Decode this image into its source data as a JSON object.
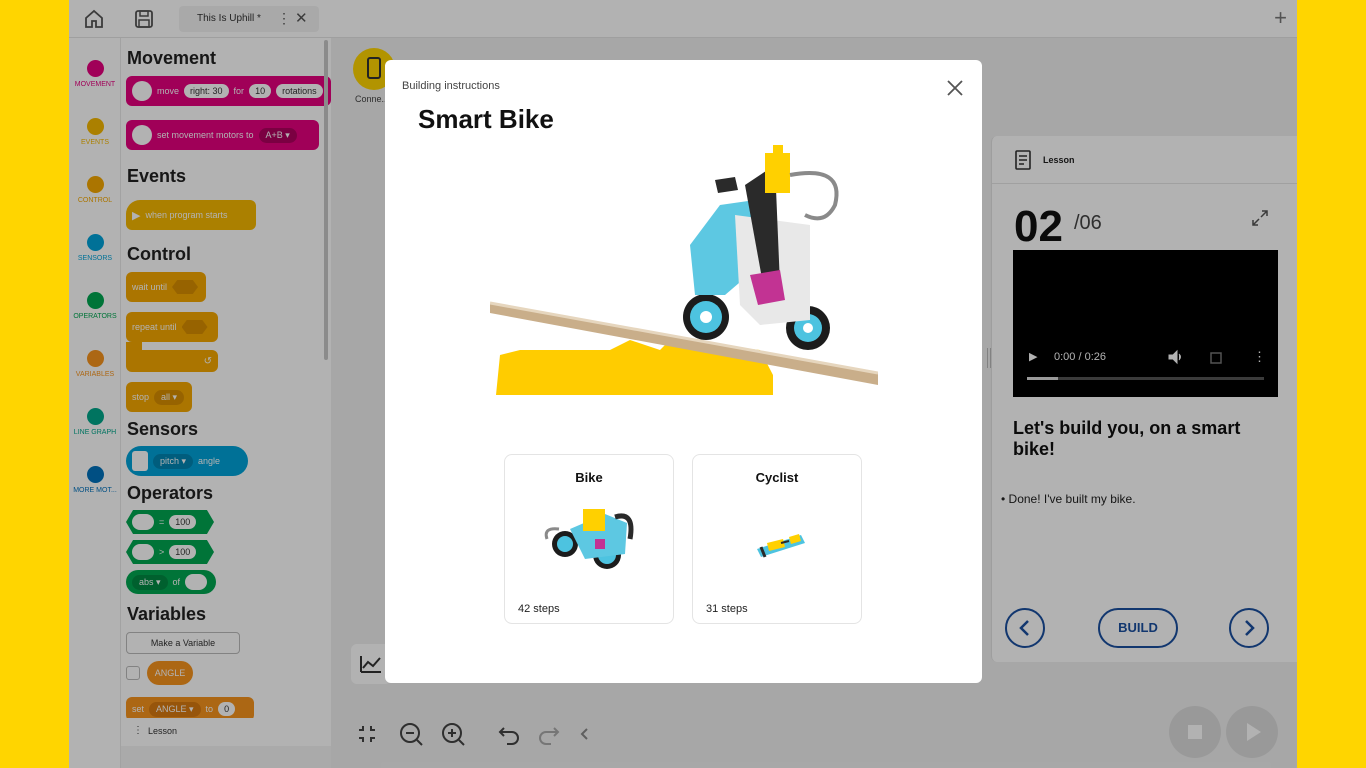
{
  "topbar": {
    "tab_title": "This Is Uphill *",
    "tab_menu": "⋮",
    "tab_close": "✕",
    "add_tab": "+"
  },
  "rail": {
    "categories": [
      {
        "label": "MOVEMENT",
        "color": "#E6007E"
      },
      {
        "label": "EVENTS",
        "color": "#F5B800"
      },
      {
        "label": "CONTROL",
        "color": "#F5A800"
      },
      {
        "label": "SENSORS",
        "color": "#00A3D9"
      },
      {
        "label": "OPERATORS",
        "color": "#00A651"
      },
      {
        "label": "VARIABLES",
        "color": "#F7941D"
      },
      {
        "label": "LINE GRAPH",
        "color": "#00A68A"
      },
      {
        "label": "MORE MOT...",
        "color": "#0071BC"
      }
    ]
  },
  "palette": {
    "movement": {
      "title": "Movement",
      "block1": {
        "move": "move",
        "direction": "right: 30",
        "for": "for",
        "amount": "10",
        "unit": "rotations"
      },
      "block2": {
        "text": "set movement motors to",
        "value": "A+B ▾"
      }
    },
    "events": {
      "title": "Events",
      "block1": "when program starts"
    },
    "control": {
      "title": "Control",
      "wait": "wait until",
      "repeat": "repeat until",
      "stop": "stop",
      "stop_value": "all ▾"
    },
    "sensors": {
      "title": "Sensors",
      "axis": "pitch ▾",
      "angle": "angle"
    },
    "operators": {
      "title": "Operators",
      "eq_sign": "=",
      "eq_value": "100",
      "gt_sign": ">",
      "gt_value": "100",
      "abs": "abs ▾",
      "of": "of"
    },
    "variables": {
      "title": "Variables",
      "make_button": "Make a Variable",
      "var_name": "ANGLE",
      "set_label": "set",
      "set_var": "ANGLE ▾",
      "to": "to",
      "set_value": "0"
    },
    "footer_label": "Lesson"
  },
  "canvas": {
    "connect_label": "Conne..."
  },
  "lesson": {
    "header_title": "Lesson",
    "current": "02",
    "total": "/06",
    "video_time": "0:00 / 0:26",
    "video_progress": 0.13,
    "heading": "Let's build you, on a smart bike!",
    "bullet": "Done! I've built my bike.",
    "build_label": "BUILD"
  },
  "modal": {
    "kicker": "Building instructions",
    "title": "Smart Bike",
    "cards": [
      {
        "title": "Bike",
        "steps": "42 steps"
      },
      {
        "title": "Cyclist",
        "steps": "31 steps"
      }
    ]
  },
  "colors": {
    "frame": "#FFD500",
    "movement": "#E6007E",
    "events": "#F5B800",
    "sensors": "#00A3D9",
    "operators": "#00A651",
    "variables": "#F7941D",
    "accent_blue": "#1a4fa0"
  }
}
